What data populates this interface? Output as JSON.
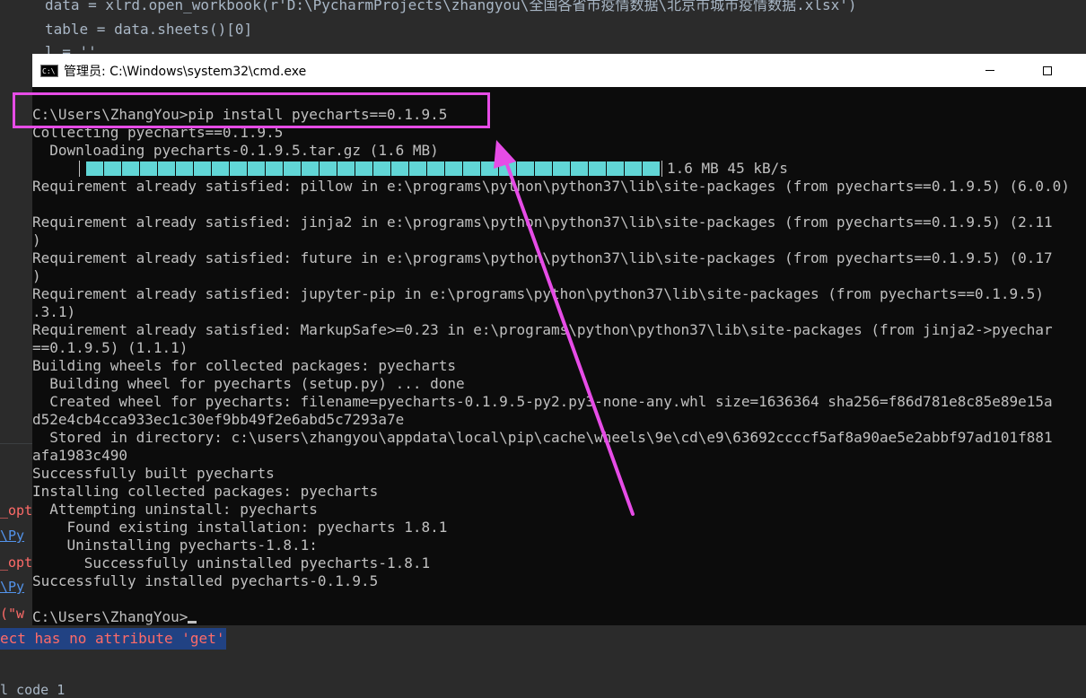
{
  "ide": {
    "code_line_1": "data = xlrd.open_workbook(r'D:\\PycharmProjects\\zhangyou\\全国各省市疫情数据\\北京市城市疫情数据.xlsx')",
    "code_line_2": "table = data.sheets()[0]",
    "code_line_3": "l = '' ",
    "left_frags": [
      "_opt",
      "\\Py",
      "_opt",
      "\\Py",
      "(\"w"
    ],
    "error_text": "ect has no attribute 'get'",
    "exit_text": "l code 1"
  },
  "window": {
    "title": "管理员: C:\\Windows\\system32\\cmd.exe",
    "icon_label": "C:\\"
  },
  "console": {
    "lines": [
      "C:\\Users\\ZhangYou>pip install pyecharts==0.1.9.5",
      "Collecting pyecharts==0.1.9.5",
      "  Downloading pyecharts-0.1.9.5.tar.gz (1.6 MB)",
      "__PROGRESS__",
      "Requirement already satisfied: pillow in e:\\programs\\python\\python37\\lib\\site-packages (from pyecharts==0.1.9.5) (6.0.0)",
      "",
      "Requirement already satisfied: jinja2 in e:\\programs\\python\\python37\\lib\\site-packages (from pyecharts==0.1.9.5) (2.11",
      ")",
      "Requirement already satisfied: future in e:\\programs\\python\\python37\\lib\\site-packages (from pyecharts==0.1.9.5) (0.17",
      ")",
      "Requirement already satisfied: jupyter-pip in e:\\programs\\python\\python37\\lib\\site-packages (from pyecharts==0.1.9.5)",
      ".3.1)",
      "Requirement already satisfied: MarkupSafe>=0.23 in e:\\programs\\python\\python37\\lib\\site-packages (from jinja2->pyechar",
      "==0.1.9.5) (1.1.1)",
      "Building wheels for collected packages: pyecharts",
      "  Building wheel for pyecharts (setup.py) ... done",
      "  Created wheel for pyecharts: filename=pyecharts-0.1.9.5-py2.py3-none-any.whl size=1636364 sha256=f86d781e8c85e89e15a",
      "d52e4cb4cca933ec1c30ef9bb49f2e6abd5c7293a7e",
      "  Stored in directory: c:\\users\\zhangyou\\appdata\\local\\pip\\cache\\wheels\\9e\\cd\\e9\\63692ccccf5af8a90ae5e2abbf97ad101f881",
      "afa1983c490",
      "Successfully built pyecharts",
      "Installing collected packages: pyecharts",
      "  Attempting uninstall: pyecharts",
      "    Found existing installation: pyecharts 1.8.1",
      "    Uninstalling pyecharts-1.8.1:",
      "      Successfully uninstalled pyecharts-1.8.1",
      "Successfully installed pyecharts-0.1.9.5",
      "",
      "__PROMPT__"
    ],
    "progress_text": "1.6 MB 45 kB/s",
    "progress_fraction": 1.0,
    "prompt": "C:\\Users\\ZhangYou>"
  },
  "colors": {
    "annotation": "#e64ce6",
    "progress": "#61d6d6",
    "console_text": "#c0c0c0",
    "console_bg": "#0c0c0c"
  }
}
